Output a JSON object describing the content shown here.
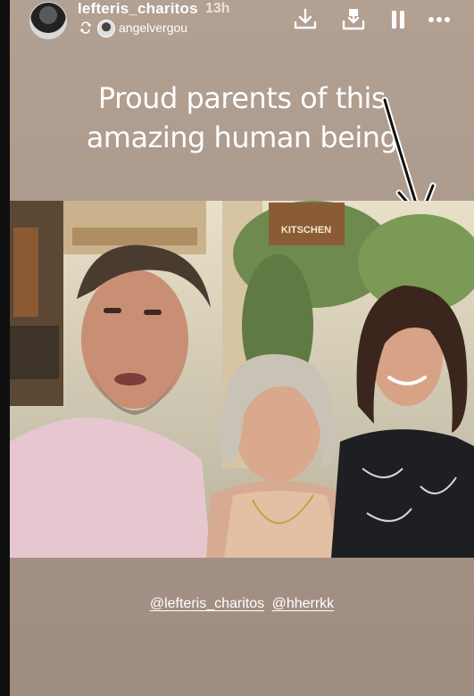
{
  "header": {
    "username": "lefteris_charitos",
    "time_ago": "13h",
    "reposted_from": "angelvergou",
    "icons": {
      "repost": "repost-icon",
      "download": "download-icon",
      "save": "save-to-collection-icon",
      "pause": "pause-icon",
      "more": "more-options-icon"
    }
  },
  "caption": {
    "line1": "Proud parents of this",
    "line2": "amazing human being"
  },
  "photo": {
    "sign_text": "KITSCHEN"
  },
  "mentions": [
    "@lefteris_charitos",
    "@hherrkk"
  ],
  "colors": {
    "story_background": "#a99689",
    "text": "#ffffff"
  }
}
